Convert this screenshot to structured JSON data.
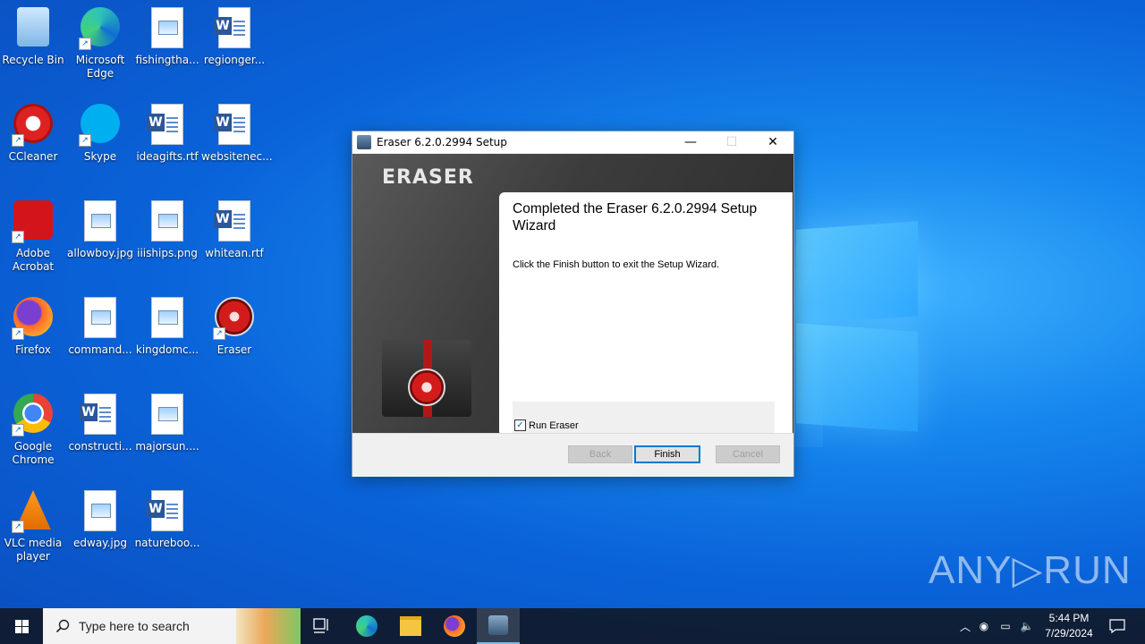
{
  "desktop": {
    "icons": [
      {
        "label": "Recycle Bin",
        "type": "recycle-bin"
      },
      {
        "label": "Microsoft Edge",
        "type": "edge"
      },
      {
        "label": "fishingtha...",
        "type": "image-file"
      },
      {
        "label": "regionger...",
        "type": "word-file"
      },
      {
        "label": "CCleaner",
        "type": "ccleaner"
      },
      {
        "label": "Skype",
        "type": "skype"
      },
      {
        "label": "ideagifts.rtf",
        "type": "word-file"
      },
      {
        "label": "websitenec...",
        "type": "word-file"
      },
      {
        "label": "Adobe Acrobat",
        "type": "acrobat"
      },
      {
        "label": "allowboy.jpg",
        "type": "image-file"
      },
      {
        "label": "iiiships.png",
        "type": "image-file"
      },
      {
        "label": "whitean.rtf",
        "type": "word-file"
      },
      {
        "label": "Firefox",
        "type": "firefox"
      },
      {
        "label": "command...",
        "type": "image-file"
      },
      {
        "label": "kingdomc...",
        "type": "image-file"
      },
      {
        "label": "Eraser",
        "type": "eraser"
      },
      {
        "label": "Google Chrome",
        "type": "chrome"
      },
      {
        "label": "constructi...",
        "type": "word-file"
      },
      {
        "label": "majorsun....",
        "type": "image-file"
      },
      {
        "label": "VLC media player",
        "type": "vlc"
      },
      {
        "label": "edway.jpg",
        "type": "image-file"
      },
      {
        "label": "natureboo...",
        "type": "word-file"
      }
    ]
  },
  "installer": {
    "title": "Eraser 6.2.0.2994 Setup",
    "brand": "ERASER",
    "heading": "Completed the Eraser 6.2.0.2994 Setup Wizard",
    "message": "Click the Finish button to exit the Setup Wizard.",
    "checkbox_label": "Run Eraser",
    "checkbox_checked": true,
    "buttons": {
      "back": "Back",
      "finish": "Finish",
      "cancel": "Cancel"
    },
    "window_controls": {
      "minimize": "—",
      "maximize": "☐",
      "close": "✕"
    }
  },
  "watermark": "ANY▷RUN",
  "taskbar": {
    "search_placeholder": "Type here to search",
    "pinned": [
      "task-view",
      "edge",
      "file-explorer",
      "firefox",
      "installer"
    ],
    "clock_time": "5:44 PM",
    "clock_date": "7/29/2024"
  },
  "colors": {
    "accent": "#0078d7",
    "desktop": "#0a63d9",
    "taskbar": "#101c30"
  }
}
